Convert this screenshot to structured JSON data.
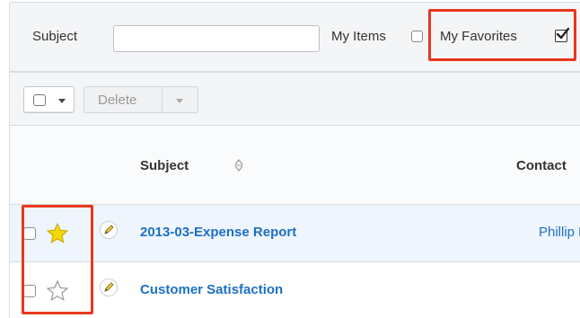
{
  "filter": {
    "subject_label": "Subject",
    "subject_value": "",
    "subject_placeholder": "",
    "my_items_label": "My Items",
    "my_items_checked": false,
    "my_favorites_label": "My Favorites",
    "my_favorites_checked": true
  },
  "actions": {
    "delete_label": "Delete"
  },
  "table": {
    "columns": [
      "Subject",
      "Contact"
    ],
    "rows": [
      {
        "favorite": true,
        "subject": "2013-03-Expense Report",
        "contact": "Phillip Fr"
      },
      {
        "favorite": false,
        "subject": "Customer Satisfaction",
        "contact": ""
      }
    ]
  },
  "colors": {
    "highlight": "#e8371e",
    "link": "#1d70c4",
    "favorite_star": "#f5d90a",
    "selected_row": "#eef5fd"
  },
  "icons": [
    "checkbox-icon",
    "checkmark-icon",
    "caret-down-icon",
    "sort-icon",
    "star-icon",
    "pencil-icon"
  ]
}
